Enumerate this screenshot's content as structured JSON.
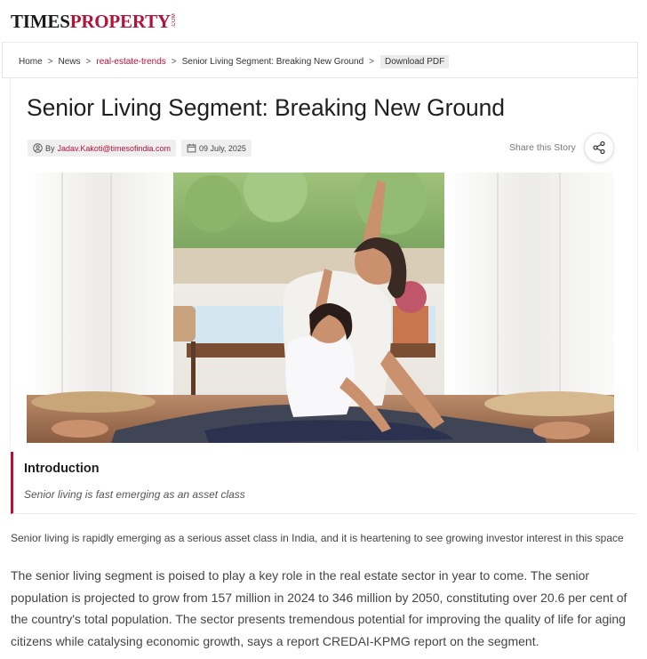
{
  "brand": {
    "times": "TIMES",
    "property": "PROPERTY",
    "dotcom": ".COM"
  },
  "breadcrumb": {
    "items": [
      "Home",
      "News",
      "real-estate-trends",
      "Senior Living Segment: Breaking New Ground"
    ],
    "separator": ">",
    "download": "Download PDF"
  },
  "article": {
    "title": "Senior Living Segment: Breaking New Ground",
    "by_prefix": "By",
    "author": "Jadav.Kakoti@timesofindia.com",
    "date": "09 July, 2025",
    "share_label": "Share this Story",
    "hero_icon": "photo-mother-daughter-yoga"
  },
  "introduction": {
    "heading": "Introduction",
    "subheading": "Senior living is fast emerging as an asset class"
  },
  "body": {
    "para1": "Senior living is rapidly emerging as a serious asset class in India, and it is heartening to see growing investor interest in this space",
    "para2": "The senior living segment is poised to play a key role in the real estate sector in year to come. The senior population is projected to grow from 157 million in 2024 to 346 million by 2050, constituting over 20.6 per cent of the country's total population. The sector presents tremendous potential for improving the quality of life for aging citizens while catalysing economic growth, says a report CREDAI-KPMG report on the segment."
  },
  "colors": {
    "accent": "#b5123a",
    "text": "#1f1f1f",
    "muted": "#777777"
  }
}
